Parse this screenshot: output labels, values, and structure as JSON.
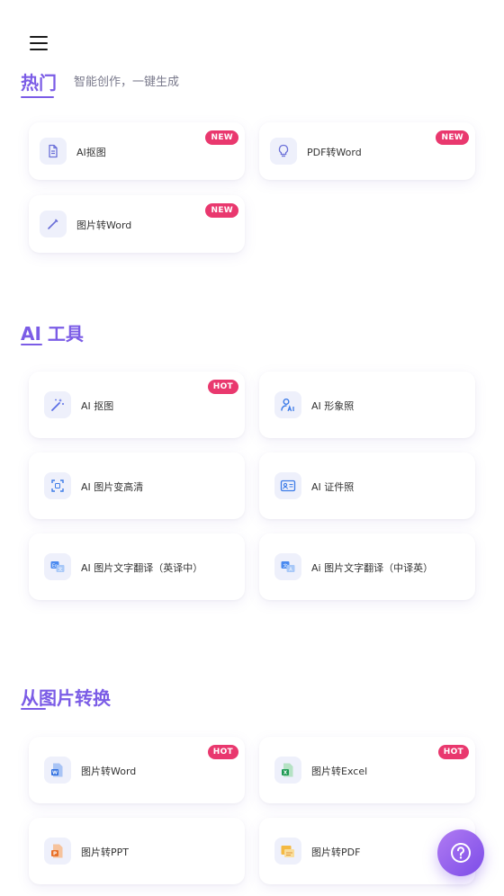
{
  "header": {
    "menu_icon": "hamburger-menu-icon"
  },
  "hot": {
    "title": "热门",
    "subtitle": "智能创作，一键生成",
    "items": [
      {
        "label": "AI抠图",
        "badge": "NEW",
        "icon": "document-icon"
      },
      {
        "label": "PDF转Word",
        "badge": "NEW",
        "icon": "lightbulb-icon"
      },
      {
        "label": "图片转Word",
        "badge": "NEW",
        "icon": "pen-icon"
      }
    ]
  },
  "ai_tools": {
    "title": "AI 工具",
    "items": [
      {
        "label": "AI 抠图",
        "badge": "HOT",
        "icon": "magic-wand-icon"
      },
      {
        "label": "AI 形象照",
        "badge": "",
        "icon": "ai-portrait-icon"
      },
      {
        "label": "AI 图片变高清",
        "badge": "",
        "icon": "enhance-frame-icon"
      },
      {
        "label": "AI 证件照",
        "badge": "",
        "icon": "id-card-icon"
      },
      {
        "label": "AI 图片文字翻译（英译中）",
        "badge": "",
        "icon": "translate-en-zh-icon"
      },
      {
        "label": "Ai 图片文字翻译（中译英）",
        "badge": "",
        "icon": "translate-zh-en-icon"
      }
    ]
  },
  "convert": {
    "title": "从图片转换",
    "items": [
      {
        "label": "图片转Word",
        "badge": "HOT",
        "icon": "word-file-icon"
      },
      {
        "label": "图片转Excel",
        "badge": "HOT",
        "icon": "excel-file-icon"
      },
      {
        "label": "图片转PPT",
        "badge": "",
        "icon": "ppt-file-icon"
      },
      {
        "label": "图片转PDF",
        "badge": "",
        "icon": "pdf-file-icon"
      }
    ]
  },
  "help_button": {
    "icon": "help-question-icon"
  },
  "colors": {
    "accent": "#7b5ce6",
    "badge": "#e9386e",
    "icon_bg": "#eef0fb"
  }
}
